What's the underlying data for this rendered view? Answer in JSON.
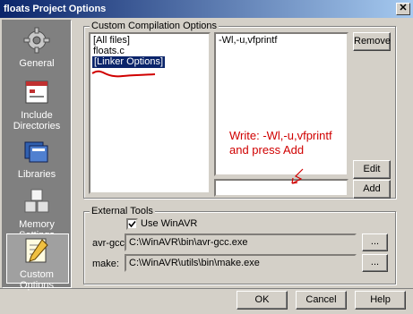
{
  "window": {
    "title": "floats Project Options",
    "close_glyph": "✕"
  },
  "nav": {
    "items": [
      {
        "label": "General",
        "icon": "gear-icon"
      },
      {
        "label": "Include Directories",
        "icon": "window-icon"
      },
      {
        "label": "Libraries",
        "icon": "books-icon"
      },
      {
        "label": "Memory Settings",
        "icon": "cubes-icon"
      },
      {
        "label": "Custom Options",
        "icon": "notepad-pencil-icon",
        "selected": true
      }
    ]
  },
  "custom_compilation": {
    "title": "Custom Compilation Options",
    "files": [
      "[All files]",
      "floats.c",
      "[Linker Options]"
    ],
    "options": [
      "-Wl,-u,vfprintf"
    ],
    "remove_label": "Remove",
    "edit_label": "Edit",
    "add_label": "Add",
    "new_option_value": ""
  },
  "annotation": {
    "line1": "Write: -Wl,-u,vfprintf",
    "line2": "and press Add",
    "color": "#d00000"
  },
  "external_tools": {
    "title": "External Tools",
    "use_winavr_label": "Use WinAVR",
    "use_winavr_checked": true,
    "avr_gcc_label": "avr-gcc:",
    "avr_gcc_path": "C:\\WinAVR\\bin\\avr-gcc.exe",
    "make_label": "make:",
    "make_path": "C:\\WinAVR\\utils\\bin\\make.exe",
    "browse_label": "..."
  },
  "footer": {
    "ok_label": "OK",
    "cancel_label": "Cancel",
    "help_label": "Help"
  }
}
